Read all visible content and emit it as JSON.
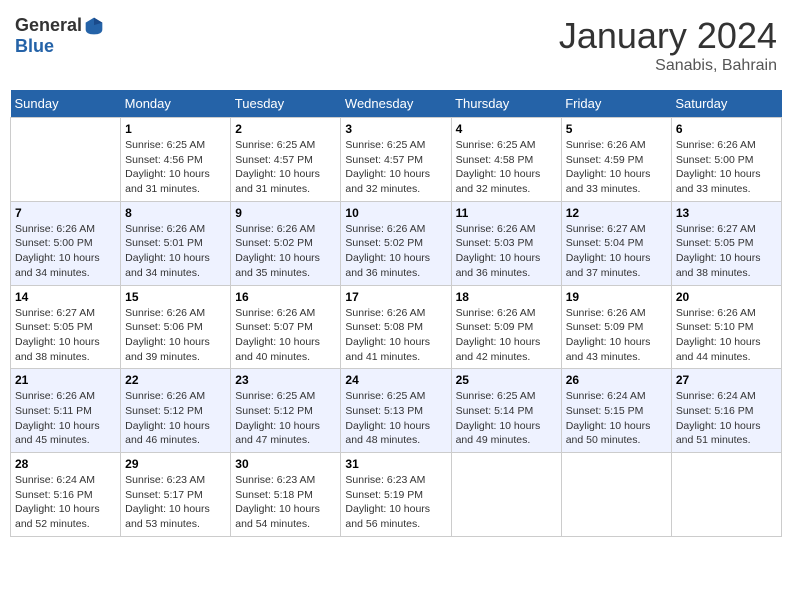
{
  "header": {
    "logo_general": "General",
    "logo_blue": "Blue",
    "month_title": "January 2024",
    "subtitle": "Sanabis, Bahrain"
  },
  "weekdays": [
    "Sunday",
    "Monday",
    "Tuesday",
    "Wednesday",
    "Thursday",
    "Friday",
    "Saturday"
  ],
  "weeks": [
    [
      {
        "day": "",
        "sunrise": "",
        "sunset": "",
        "daylight": ""
      },
      {
        "day": "1",
        "sunrise": "Sunrise: 6:25 AM",
        "sunset": "Sunset: 4:56 PM",
        "daylight": "Daylight: 10 hours and 31 minutes."
      },
      {
        "day": "2",
        "sunrise": "Sunrise: 6:25 AM",
        "sunset": "Sunset: 4:57 PM",
        "daylight": "Daylight: 10 hours and 31 minutes."
      },
      {
        "day": "3",
        "sunrise": "Sunrise: 6:25 AM",
        "sunset": "Sunset: 4:57 PM",
        "daylight": "Daylight: 10 hours and 32 minutes."
      },
      {
        "day": "4",
        "sunrise": "Sunrise: 6:25 AM",
        "sunset": "Sunset: 4:58 PM",
        "daylight": "Daylight: 10 hours and 32 minutes."
      },
      {
        "day": "5",
        "sunrise": "Sunrise: 6:26 AM",
        "sunset": "Sunset: 4:59 PM",
        "daylight": "Daylight: 10 hours and 33 minutes."
      },
      {
        "day": "6",
        "sunrise": "Sunrise: 6:26 AM",
        "sunset": "Sunset: 5:00 PM",
        "daylight": "Daylight: 10 hours and 33 minutes."
      }
    ],
    [
      {
        "day": "7",
        "sunrise": "Sunrise: 6:26 AM",
        "sunset": "Sunset: 5:00 PM",
        "daylight": "Daylight: 10 hours and 34 minutes."
      },
      {
        "day": "8",
        "sunrise": "Sunrise: 6:26 AM",
        "sunset": "Sunset: 5:01 PM",
        "daylight": "Daylight: 10 hours and 34 minutes."
      },
      {
        "day": "9",
        "sunrise": "Sunrise: 6:26 AM",
        "sunset": "Sunset: 5:02 PM",
        "daylight": "Daylight: 10 hours and 35 minutes."
      },
      {
        "day": "10",
        "sunrise": "Sunrise: 6:26 AM",
        "sunset": "Sunset: 5:02 PM",
        "daylight": "Daylight: 10 hours and 36 minutes."
      },
      {
        "day": "11",
        "sunrise": "Sunrise: 6:26 AM",
        "sunset": "Sunset: 5:03 PM",
        "daylight": "Daylight: 10 hours and 36 minutes."
      },
      {
        "day": "12",
        "sunrise": "Sunrise: 6:27 AM",
        "sunset": "Sunset: 5:04 PM",
        "daylight": "Daylight: 10 hours and 37 minutes."
      },
      {
        "day": "13",
        "sunrise": "Sunrise: 6:27 AM",
        "sunset": "Sunset: 5:05 PM",
        "daylight": "Daylight: 10 hours and 38 minutes."
      }
    ],
    [
      {
        "day": "14",
        "sunrise": "Sunrise: 6:27 AM",
        "sunset": "Sunset: 5:05 PM",
        "daylight": "Daylight: 10 hours and 38 minutes."
      },
      {
        "day": "15",
        "sunrise": "Sunrise: 6:26 AM",
        "sunset": "Sunset: 5:06 PM",
        "daylight": "Daylight: 10 hours and 39 minutes."
      },
      {
        "day": "16",
        "sunrise": "Sunrise: 6:26 AM",
        "sunset": "Sunset: 5:07 PM",
        "daylight": "Daylight: 10 hours and 40 minutes."
      },
      {
        "day": "17",
        "sunrise": "Sunrise: 6:26 AM",
        "sunset": "Sunset: 5:08 PM",
        "daylight": "Daylight: 10 hours and 41 minutes."
      },
      {
        "day": "18",
        "sunrise": "Sunrise: 6:26 AM",
        "sunset": "Sunset: 5:09 PM",
        "daylight": "Daylight: 10 hours and 42 minutes."
      },
      {
        "day": "19",
        "sunrise": "Sunrise: 6:26 AM",
        "sunset": "Sunset: 5:09 PM",
        "daylight": "Daylight: 10 hours and 43 minutes."
      },
      {
        "day": "20",
        "sunrise": "Sunrise: 6:26 AM",
        "sunset": "Sunset: 5:10 PM",
        "daylight": "Daylight: 10 hours and 44 minutes."
      }
    ],
    [
      {
        "day": "21",
        "sunrise": "Sunrise: 6:26 AM",
        "sunset": "Sunset: 5:11 PM",
        "daylight": "Daylight: 10 hours and 45 minutes."
      },
      {
        "day": "22",
        "sunrise": "Sunrise: 6:26 AM",
        "sunset": "Sunset: 5:12 PM",
        "daylight": "Daylight: 10 hours and 46 minutes."
      },
      {
        "day": "23",
        "sunrise": "Sunrise: 6:25 AM",
        "sunset": "Sunset: 5:12 PM",
        "daylight": "Daylight: 10 hours and 47 minutes."
      },
      {
        "day": "24",
        "sunrise": "Sunrise: 6:25 AM",
        "sunset": "Sunset: 5:13 PM",
        "daylight": "Daylight: 10 hours and 48 minutes."
      },
      {
        "day": "25",
        "sunrise": "Sunrise: 6:25 AM",
        "sunset": "Sunset: 5:14 PM",
        "daylight": "Daylight: 10 hours and 49 minutes."
      },
      {
        "day": "26",
        "sunrise": "Sunrise: 6:24 AM",
        "sunset": "Sunset: 5:15 PM",
        "daylight": "Daylight: 10 hours and 50 minutes."
      },
      {
        "day": "27",
        "sunrise": "Sunrise: 6:24 AM",
        "sunset": "Sunset: 5:16 PM",
        "daylight": "Daylight: 10 hours and 51 minutes."
      }
    ],
    [
      {
        "day": "28",
        "sunrise": "Sunrise: 6:24 AM",
        "sunset": "Sunset: 5:16 PM",
        "daylight": "Daylight: 10 hours and 52 minutes."
      },
      {
        "day": "29",
        "sunrise": "Sunrise: 6:23 AM",
        "sunset": "Sunset: 5:17 PM",
        "daylight": "Daylight: 10 hours and 53 minutes."
      },
      {
        "day": "30",
        "sunrise": "Sunrise: 6:23 AM",
        "sunset": "Sunset: 5:18 PM",
        "daylight": "Daylight: 10 hours and 54 minutes."
      },
      {
        "day": "31",
        "sunrise": "Sunrise: 6:23 AM",
        "sunset": "Sunset: 5:19 PM",
        "daylight": "Daylight: 10 hours and 56 minutes."
      },
      {
        "day": "",
        "sunrise": "",
        "sunset": "",
        "daylight": ""
      },
      {
        "day": "",
        "sunrise": "",
        "sunset": "",
        "daylight": ""
      },
      {
        "day": "",
        "sunrise": "",
        "sunset": "",
        "daylight": ""
      }
    ]
  ]
}
